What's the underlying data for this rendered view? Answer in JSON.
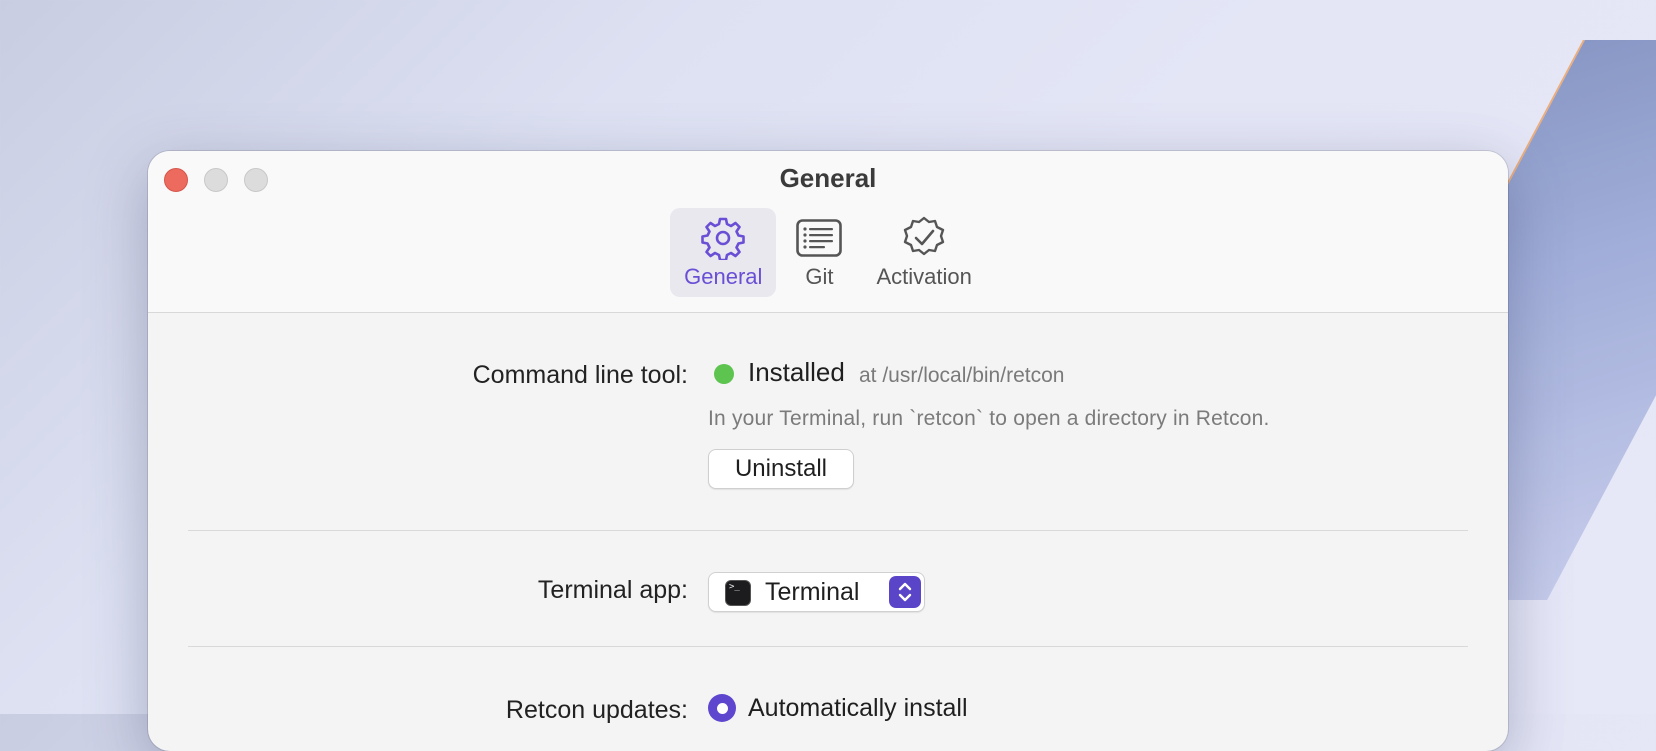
{
  "window": {
    "title": "General"
  },
  "tabs": [
    {
      "label": "General",
      "icon": "gear-icon",
      "active": true
    },
    {
      "label": "Git",
      "icon": "list-icon",
      "active": false
    },
    {
      "label": "Activation",
      "icon": "verified-badge-icon",
      "active": false
    }
  ],
  "command_line_tool": {
    "label": "Command line tool:",
    "status": "Installed",
    "status_color": "#5cc44f",
    "path": "at /usr/local/bin/retcon",
    "hint": "In your Terminal, run `retcon` to open a directory in Retcon.",
    "button": "Uninstall"
  },
  "terminal_app": {
    "label": "Terminal app:",
    "selected": "Terminal",
    "icon": "terminal-icon"
  },
  "updates": {
    "label": "Retcon updates:",
    "option": "Automatically install",
    "selected": true
  },
  "colors": {
    "accent": "#5f46cf"
  }
}
